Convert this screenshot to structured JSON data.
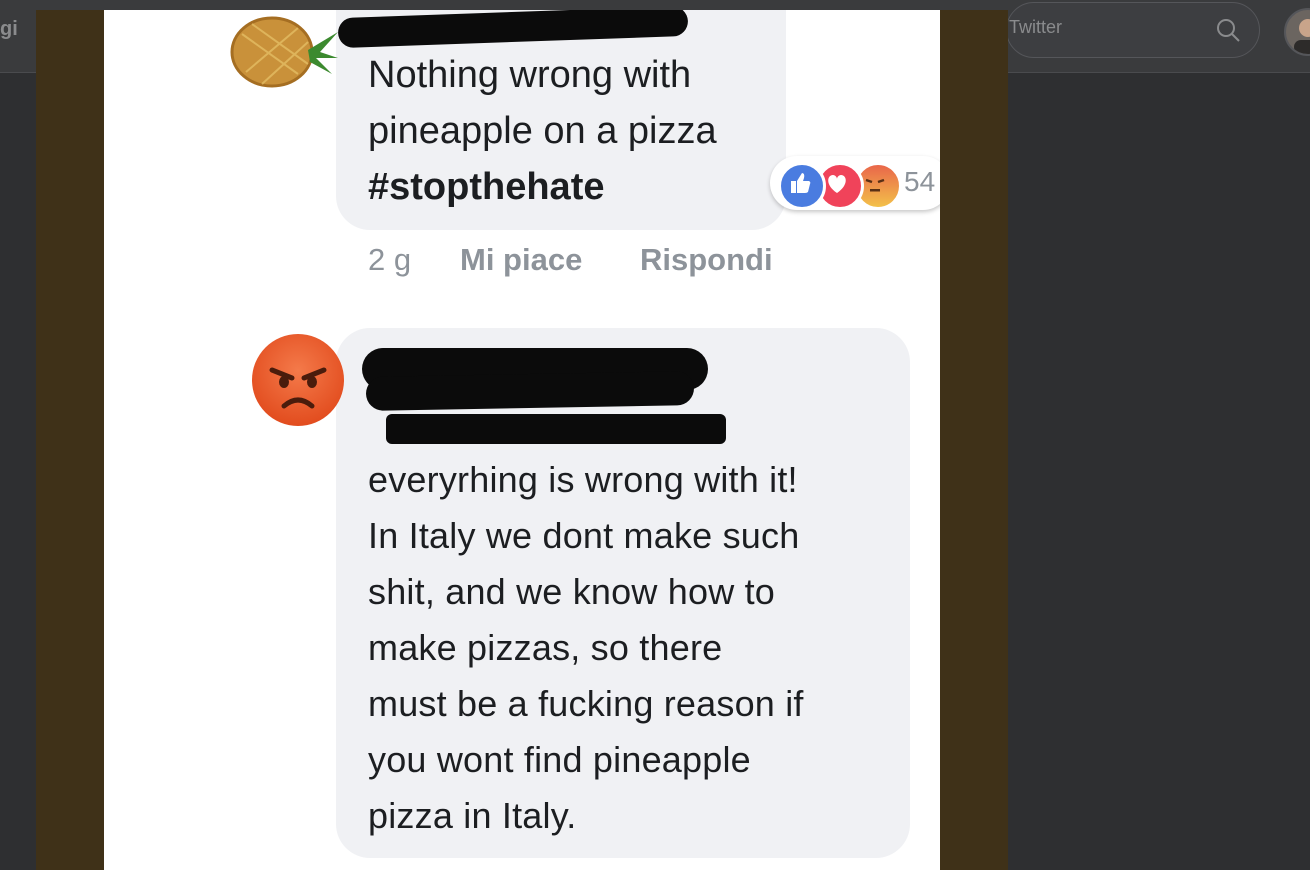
{
  "background_page": {
    "left_text": "gi",
    "search_placeholder": "Twitter"
  },
  "post": {
    "comment1": {
      "lines": [
        "Nothing wrong with",
        "pineapple on a pizza"
      ],
      "hashtag": "#stopthehate",
      "time": "2 g",
      "like_label": "Mi piace",
      "reply_label": "Rispondi",
      "reaction_count": "54",
      "avatar": "pineapple-emoji"
    },
    "comment2": {
      "lines": [
        "everyrhing is wrong with it!",
        "In Italy we dont make such",
        "shit, and we know how to",
        "make pizzas, so there",
        "must be a fucking reason if",
        "you wont find pineapple",
        "pizza in Italy."
      ],
      "avatar": "angry-face-emoji"
    }
  },
  "colors": {
    "bubble": "#f0f1f4",
    "text": "#1c1e21",
    "meta": "#8d939a",
    "like": "#4a7ce0",
    "love": "#f0435a"
  }
}
